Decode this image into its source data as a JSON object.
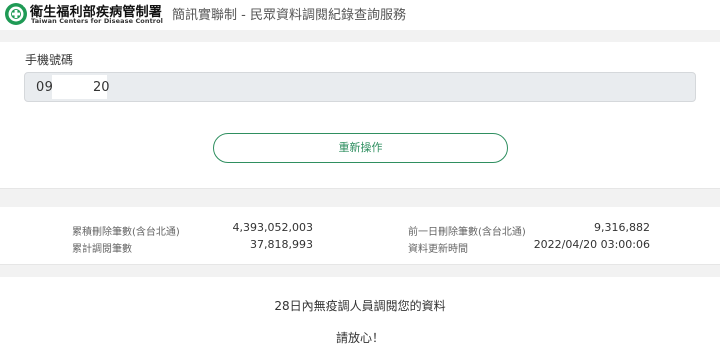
{
  "header": {
    "logo_zh": "衛生福利部疾病管制署",
    "logo_en": "Taiwan Centers for Disease Control",
    "title": "簡訊實聯制 - 民眾資料調閱紀錄查詢服務"
  },
  "form": {
    "phone_label": "手機號碼",
    "phone_prefix": "09",
    "phone_suffix": "20",
    "reset_label": "重新操作"
  },
  "stats": {
    "total_deleted_label": "累積刪除筆數(含台北通)",
    "total_deleted_value": "4,393,052,003",
    "total_accessed_label": "累計調閱筆數",
    "total_accessed_value": "37,818,993",
    "prev_day_deleted_label": "前一日刪除筆數(含台北通)",
    "prev_day_deleted_value": "9,316,882",
    "updated_label": "資料更新時間",
    "updated_value": "2022/04/20 03:00:06"
  },
  "result": {
    "message": "28日內無疫調人員調閱您的資料",
    "reassure": "請放心！"
  },
  "colors": {
    "accent": "#2f8f60",
    "logo_green": "#1f9a55",
    "band": "#f2f2f2",
    "field_bg": "#e9ecef"
  }
}
